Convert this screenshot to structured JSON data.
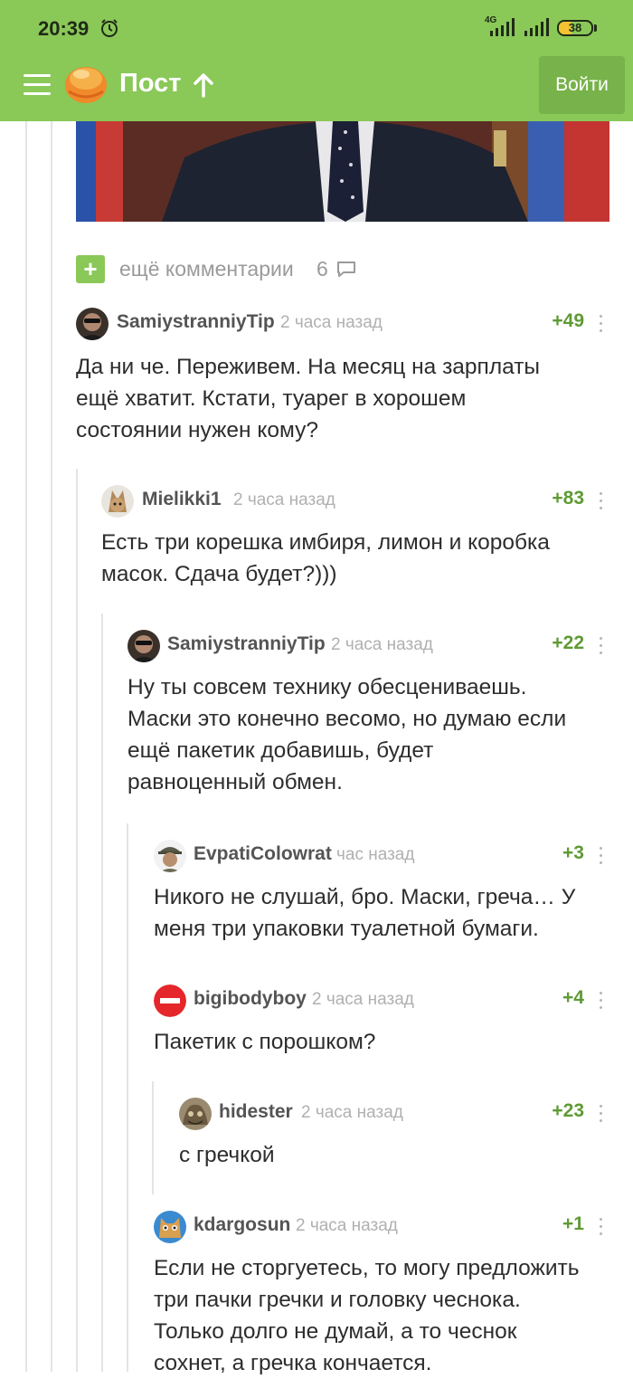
{
  "status_bar": {
    "time": "20:39",
    "network": "4G",
    "battery": "38",
    "icons": [
      "alarm-icon",
      "signal-icon",
      "signal-icon",
      "battery-icon"
    ]
  },
  "app_bar": {
    "title": "Пост",
    "login_label": "Войти",
    "icons": [
      "menu-icon",
      "logo-icon",
      "arrow-up-icon"
    ]
  },
  "more_comments": {
    "label": "ещё комментарии",
    "count": "6"
  },
  "comments": [
    {
      "author": "SamiystranniyTip",
      "time": "2 часа назад",
      "rating": "+49",
      "lines": [
        "Да ни че. Переживем. На месяц на зарплаты",
        "ещё хватит. Кстати, туарег в хорошем",
        "состоянии нужен кому?"
      ]
    },
    {
      "author": "Mielikki1",
      "time": "2 часа назад",
      "rating": "+83",
      "lines": [
        "Есть три корешка имбиря, лимон и коробка",
        "масок. Сдача будет?)))"
      ]
    },
    {
      "author": "SamiystranniyTip",
      "time": "2 часа назад",
      "rating": "+22",
      "lines": [
        "Ну ты совсем технику обесцениваешь.",
        "Маски это конечно весомо, но думаю если",
        "ещё пакетик добавишь, будет",
        "равноценный обмен."
      ]
    },
    {
      "author": "EvpatiColowrat",
      "time": "час назад",
      "rating": "+3",
      "lines": [
        "Никого не слушай, бро. Маски, греча… У",
        "меня три упаковки туалетной бумаги."
      ]
    },
    {
      "author": "bigibodyboy",
      "time": "2 часа назад",
      "rating": "+4",
      "lines": [
        "Пакетик с порошком?"
      ]
    },
    {
      "author": "hidester",
      "time": "2 часа назад",
      "rating": "+23",
      "lines": [
        "с гречкой"
      ]
    },
    {
      "author": "kdargosun",
      "time": "2 часа назад",
      "rating": "+1",
      "lines": [
        "Если не сторгуетесь, то могу предложить",
        "три пачки гречки и головку чеснока.",
        "Только долго не думай, а то чеснок",
        "сохнет, а гречка кончается."
      ]
    }
  ],
  "colors": {
    "brand_green": "#8ac858",
    "rating_green": "#5f9a35"
  }
}
